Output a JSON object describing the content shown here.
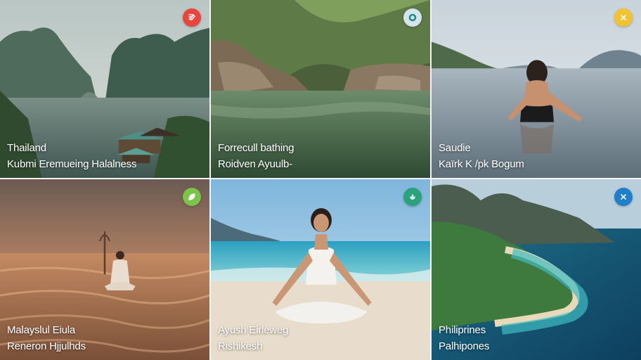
{
  "tiles": [
    {
      "title": "Thailand",
      "subtitle": "Kubmi Eremueing Halalness",
      "badge_color": "#e8453c",
      "badge_icon": "edit-icon"
    },
    {
      "title": "Forrecull bathing",
      "subtitle": "Roidven Ayuulb-",
      "badge_color": "#d6e3ec",
      "badge_icon": "ring-icon"
    },
    {
      "title": "Saudie",
      "subtitle": "Kaïrk K /pk Bogum",
      "badge_color": "#f2c230",
      "badge_icon": "close-icon"
    },
    {
      "title": "Malayslul Eiula",
      "subtitle": "Reneron Hjjulhds",
      "badge_color": "#7cc34a",
      "badge_icon": "leaf-icon"
    },
    {
      "title": "Ayush Eirleweg",
      "subtitle": "Rishikesh",
      "badge_color": "#2aa37c",
      "badge_icon": "lotus-icon"
    },
    {
      "title": "Philiprines",
      "subtitle": "Palhipones",
      "badge_color": "#1f7fc8",
      "badge_icon": "close-icon"
    }
  ]
}
